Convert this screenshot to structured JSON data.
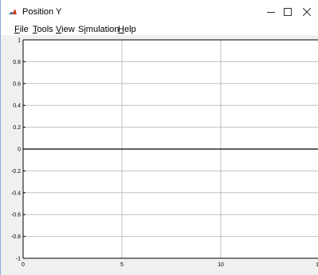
{
  "window": {
    "title": "Position Y"
  },
  "menu": {
    "file_pre": "",
    "file_u": "F",
    "file_post": "ile",
    "tools_pre": "",
    "tools_u": "T",
    "tools_post": "ools",
    "view_pre": "",
    "view_u": "V",
    "view_post": "iew",
    "simulation_pre": "S",
    "simulation_u": "i",
    "simulation_post": "mulation",
    "help_pre": "",
    "help_u": "H",
    "help_post": "elp"
  },
  "chart_data": {
    "type": "line",
    "title": "",
    "xlabel": "",
    "ylabel": "",
    "xlim": [
      0,
      15
    ],
    "ylim": [
      -1,
      1
    ],
    "grid": true,
    "x_ticks": [
      "0",
      "5",
      "10",
      "1"
    ],
    "y_ticks": [
      "1",
      "0.8",
      "0.6",
      "0.4",
      "0.2",
      "0",
      "-0.2",
      "-0.4",
      "-0.6",
      "-0.8",
      "-1"
    ],
    "series": [
      {
        "x": [
          0,
          15
        ],
        "y": [
          0,
          0
        ]
      }
    ],
    "colors": {
      "line": "#000000",
      "grid": "#c0c0c0",
      "axes": "#000000"
    }
  }
}
